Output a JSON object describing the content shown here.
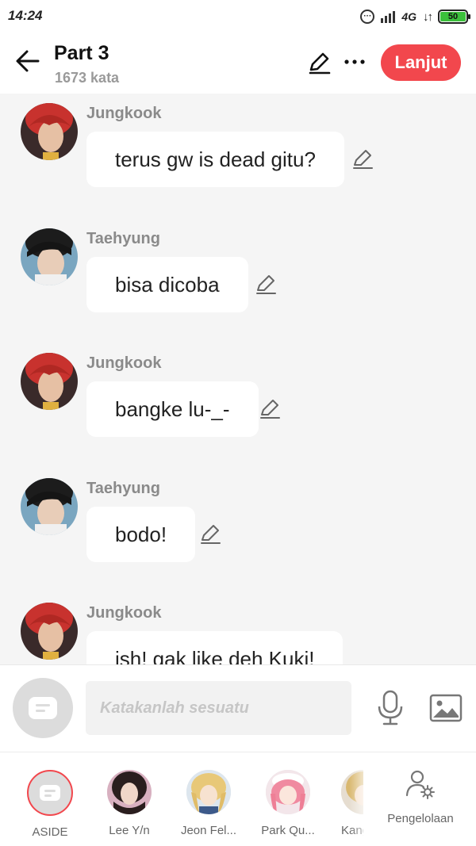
{
  "status_bar": {
    "time": "14:24",
    "network": "4G",
    "battery": "50"
  },
  "header": {
    "title": "Part 3",
    "word_count": "1673 kata",
    "next_label": "Lanjut"
  },
  "messages": [
    {
      "sender": "Jungkook",
      "text": "terus gw is dead gitu?"
    },
    {
      "sender": "Taehyung",
      "text": "bisa dicoba"
    },
    {
      "sender": "Jungkook",
      "text": "bangke lu-_-"
    },
    {
      "sender": "Taehyung",
      "text": "bodo!"
    },
    {
      "sender": "Jungkook",
      "text": "ish! gak like deh Kuki!"
    }
  ],
  "input": {
    "placeholder": "Katakanlah sesuatu"
  },
  "characters": [
    {
      "label": "ASIDE"
    },
    {
      "label": "Lee Y/n"
    },
    {
      "label": "Jeon Fel..."
    },
    {
      "label": "Park Qu..."
    },
    {
      "label": "Kang"
    }
  ],
  "manage_label": "Pengelolaan",
  "colors": {
    "accent": "#f2474d",
    "background": "#f5f5f5",
    "sender": "#8a8a8a"
  },
  "icons": [
    "back-arrow-icon",
    "pencil-icon",
    "more-icon",
    "microphone-icon",
    "image-icon",
    "person-gear-icon",
    "chat-bubble-icon"
  ]
}
